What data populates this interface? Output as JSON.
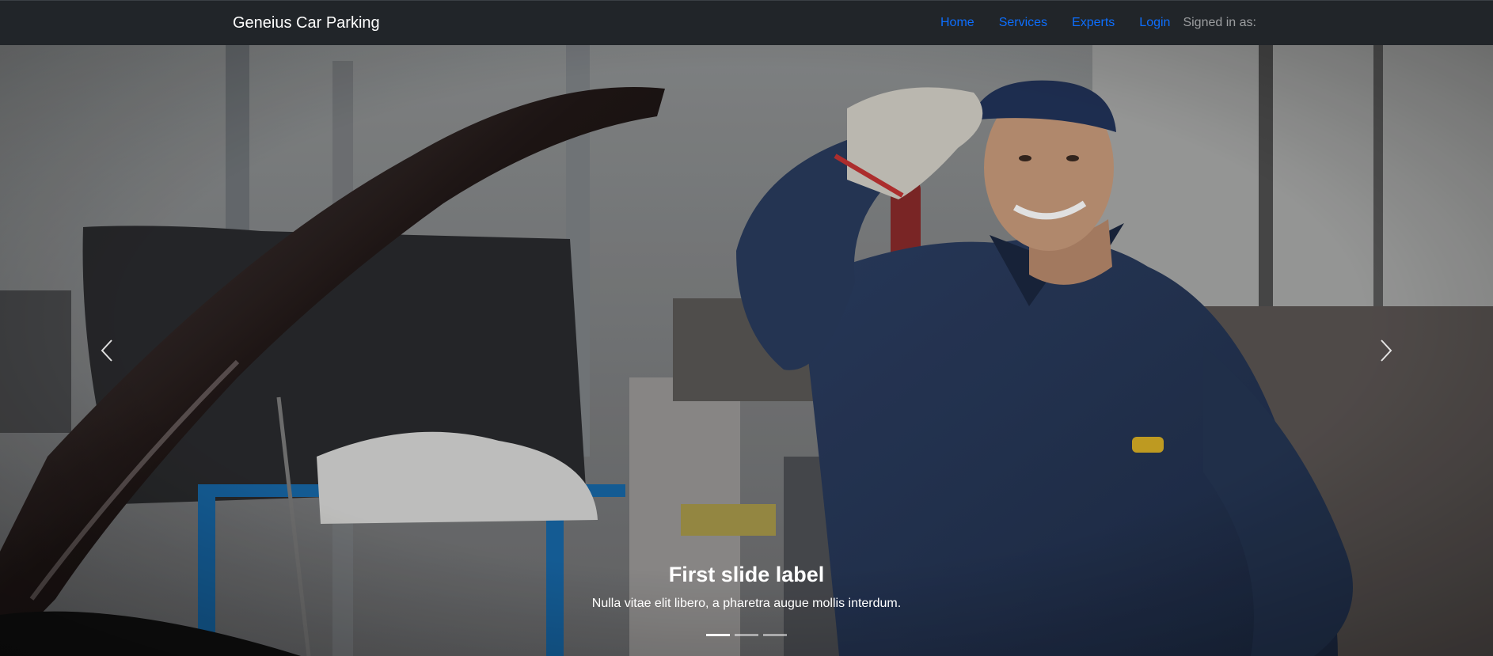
{
  "navbar": {
    "brand": "Geneius Car Parking",
    "links": [
      {
        "label": "Home"
      },
      {
        "label": "Services"
      },
      {
        "label": "Experts"
      },
      {
        "label": "Login"
      }
    ],
    "signed_in": "Signed in as:"
  },
  "carousel": {
    "active_slide": 1,
    "slide_count": 3,
    "slide": {
      "title": "First slide label",
      "text": "Nulla vitae elit libero, a pharetra augue mollis interdum."
    },
    "image_subject": "smiling mechanic in blue work uniform next to a car with its hood open in a garage",
    "prev_icon": "chevron-left-icon",
    "next_icon": "chevron-right-icon"
  },
  "colors": {
    "navbar_bg": "#212529",
    "link": "#0d6efd",
    "uniform": "#2f4670"
  }
}
